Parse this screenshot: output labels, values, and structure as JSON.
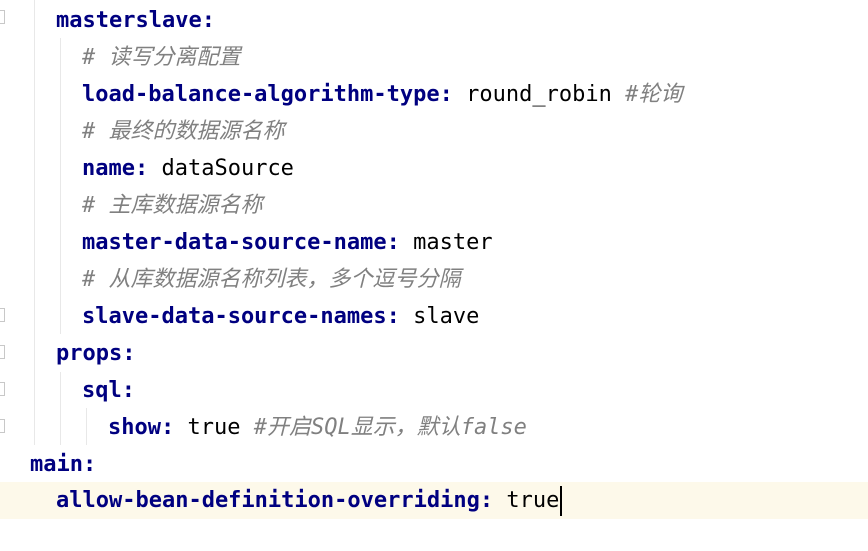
{
  "editor": {
    "caret_color": "#000000",
    "current_line_color": "#fdf9ea",
    "key_color": "#000080",
    "comment_color": "#808080",
    "lines": [
      {
        "key": "masterslave",
        "sep": ":",
        "value": "",
        "comment": ""
      },
      {
        "key": "",
        "sep": "",
        "value": "",
        "comment": "# 读写分离配置"
      },
      {
        "key": "load-balance-algorithm-type",
        "sep": ":",
        "value": " round_robin",
        "comment": " #轮询"
      },
      {
        "key": "",
        "sep": "",
        "value": "",
        "comment": "# 最终的数据源名称"
      },
      {
        "key": "name",
        "sep": ":",
        "value": " dataSource",
        "comment": ""
      },
      {
        "key": "",
        "sep": "",
        "value": "",
        "comment": "# 主库数据源名称"
      },
      {
        "key": "master-data-source-name",
        "sep": ":",
        "value": " master",
        "comment": ""
      },
      {
        "key": "",
        "sep": "",
        "value": "",
        "comment": "# 从库数据源名称列表，多个逗号分隔"
      },
      {
        "key": "slave-data-source-names",
        "sep": ":",
        "value": " slave",
        "comment": ""
      },
      {
        "key": "props",
        "sep": ":",
        "value": "",
        "comment": ""
      },
      {
        "key": "sql",
        "sep": ":",
        "value": "",
        "comment": ""
      },
      {
        "key": "show",
        "sep": ":",
        "value": " true",
        "comment": " #开启SQL显示，默认false"
      },
      {
        "key": "main",
        "sep": ":",
        "value": "",
        "comment": ""
      },
      {
        "key": "allow-bean-definition-overriding",
        "sep": ":",
        "value": " true",
        "comment": ""
      }
    ]
  }
}
